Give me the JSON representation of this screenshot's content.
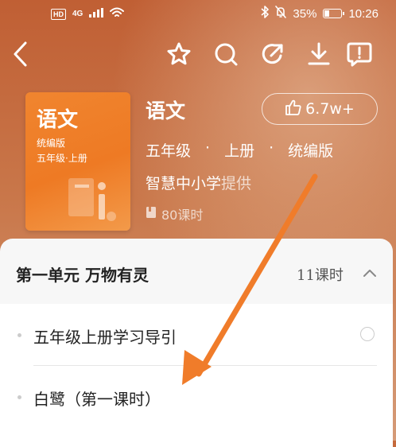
{
  "status_bar": {
    "network_hd": "HD",
    "network_type": "4G",
    "battery_percent": "35%",
    "battery_level": 0.35,
    "time": "10:26"
  },
  "nav": {
    "icons": [
      "back-icon",
      "star-icon",
      "search-icon",
      "share-icon",
      "download-icon",
      "report-icon"
    ]
  },
  "book": {
    "cover_title": "语文",
    "cover_line1": "统编版",
    "cover_line2": "五年级·上册",
    "title": "语文",
    "likes": "6.7w+",
    "grade": "五年级",
    "term": "上册",
    "edition": "统编版",
    "separator": "·",
    "provider_name": "智慧中小学",
    "provider_suffix": "提供",
    "lesson_total": "80课时"
  },
  "unit": {
    "title": "第一单元  万物有灵",
    "count": "11课时"
  },
  "items": [
    {
      "label": "五年级上册学习导引"
    },
    {
      "label": "白鹭（第一课时）"
    }
  ],
  "colors": {
    "header_bg": "#c56a3c",
    "cover": "#f0852f",
    "annotation_arrow": "#f07c2a"
  }
}
